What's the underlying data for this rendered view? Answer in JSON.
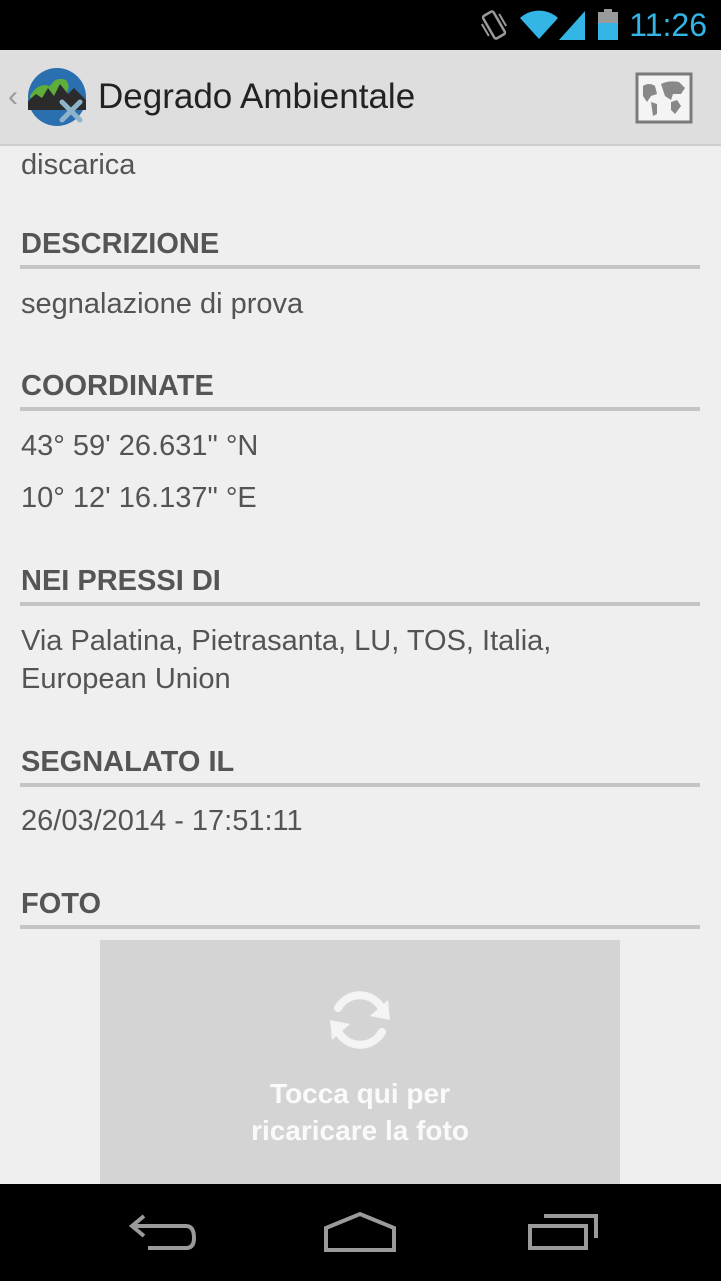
{
  "status_bar": {
    "time": "11:26",
    "icons": [
      "vibrate-icon",
      "wifi-icon",
      "signal-icon",
      "battery-icon"
    ]
  },
  "action_bar": {
    "title": "Degrado Ambientale",
    "up_icon": "chevron-left-icon",
    "logo_icon": "app-logo-icon",
    "map_icon": "map-icon"
  },
  "content": {
    "category_value": "discarica",
    "sections": [
      {
        "header": "DESCRIZIONE",
        "lines": [
          "segnalazione di prova"
        ]
      },
      {
        "header": "COORDINATE",
        "lines": [
          "43° 59' 26.631\" °N",
          "10° 12' 16.137\" °E"
        ]
      },
      {
        "header": "NEI PRESSI DI",
        "lines": [
          "Via Palatina, Pietrasanta, LU, TOS, Italia,",
          "European Union"
        ]
      },
      {
        "header": "SEGNALATO IL",
        "lines": [
          "26/03/2014 - 17:51:11"
        ]
      },
      {
        "header": "FOTO",
        "lines": []
      }
    ],
    "photo": {
      "icon": "refresh-icon",
      "label_line1": "Tocca qui per",
      "label_line2": "ricaricare la foto"
    }
  },
  "nav_bar": {
    "icons": [
      "back-icon",
      "home-icon",
      "recent-apps-icon"
    ]
  },
  "colors": {
    "accent": "#33b5e5",
    "background": "#efefef",
    "action_bar": "#dedede",
    "section_rule": "#c4c4c4",
    "photo_box": "#d4d4d4"
  }
}
